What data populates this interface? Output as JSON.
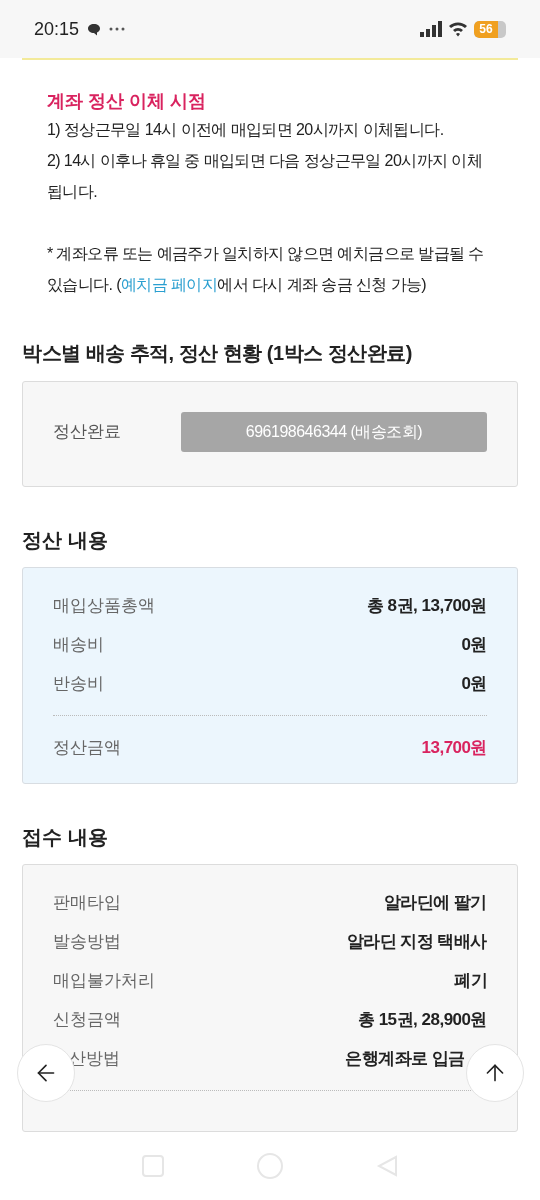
{
  "status_bar": {
    "time": "20:15",
    "battery": "56"
  },
  "notice": {
    "title": "계좌 정산 이체 시점",
    "lines": [
      "1) 정상근무일 14시 이전에 매입되면 20시까지 이체됩니다.",
      "2) 14시 이후나 휴일 중 매입되면 다음 정상근무일 20시까지 이체됩니다."
    ],
    "note_before": "* 계좌오류 또는 예금주가 일치하지 않으면 예치금으로 발급될 수 있습니다. (",
    "note_link": "예치금 페이지",
    "note_after": "에서 다시 계좌 송금 신청 가능)"
  },
  "tracking": {
    "title": "박스별 배송 추적, 정산 현황 (1박스 정산완료)",
    "boxes": [
      {
        "status": "정산완료",
        "button": "696198646344 (배송조회)"
      }
    ]
  },
  "settlement": {
    "title": "정산 내용",
    "rows": [
      {
        "label": "매입상품총액",
        "value": "총 8권, 13,700원"
      },
      {
        "label": "배송비",
        "value": "0원"
      },
      {
        "label": "반송비",
        "value": "0원"
      }
    ],
    "total": {
      "label": "정산금액",
      "value": "13,700원"
    }
  },
  "receipt": {
    "title": "접수 내용",
    "rows": [
      {
        "label": "판매타입",
        "value": "알라딘에 팔기"
      },
      {
        "label": "발송방법",
        "value": "알라딘 지정 택배사"
      },
      {
        "label": "매입불가처리",
        "value": "폐기"
      },
      {
        "label": "신청금액",
        "value": "총 15권, 28,900원"
      },
      {
        "label": "산방법",
        "value": "은행계좌로 입금"
      }
    ]
  }
}
